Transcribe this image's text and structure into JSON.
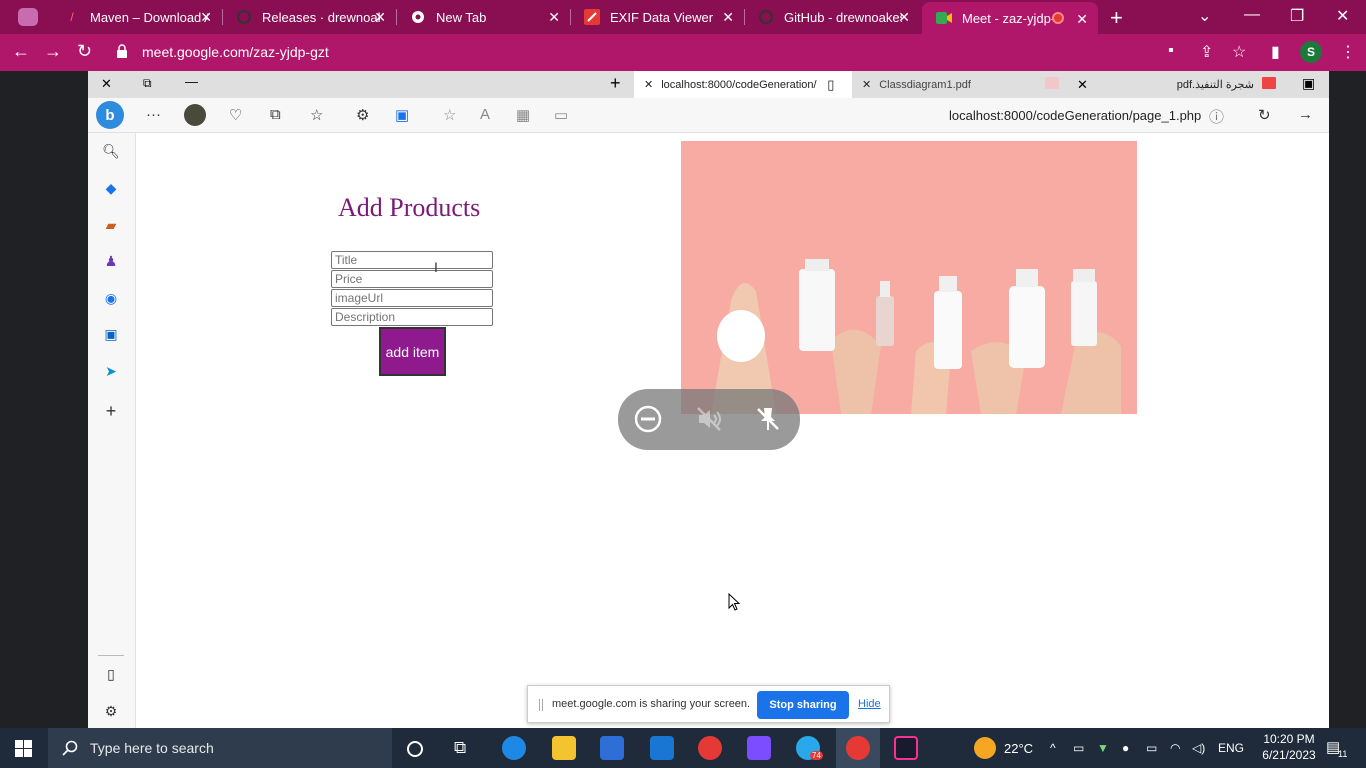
{
  "chrome": {
    "tabs": [
      {
        "title": "Maven – Download A",
        "icon": "maven-icon"
      },
      {
        "title": "Releases · drewnoake",
        "icon": "github-icon"
      },
      {
        "title": "New Tab",
        "icon": "chrome-icon"
      },
      {
        "title": "EXIF Data Viewer",
        "icon": "exif-icon"
      },
      {
        "title": "GitHub - drewnoakes",
        "icon": "github-icon"
      },
      {
        "title": "Meet - zaz-yjdp-",
        "icon": "meet-icon"
      }
    ],
    "url": "meet.google.com/zaz-yjdp-gzt",
    "profile_initial": "S"
  },
  "edge": {
    "tabs": [
      {
        "title": "localhost:8000/codeGeneration/"
      },
      {
        "title": "Classdiagram1.pdf"
      },
      {
        "title": "pdf.شجرة التنفيذ"
      }
    ],
    "url": "localhost:8000/codeGeneration/page_1.php"
  },
  "page": {
    "heading": "Add Products",
    "fields": {
      "title_placeholder": "Title",
      "price_placeholder": "Price",
      "image_placeholder": "imageUrl",
      "description_placeholder": "Description"
    },
    "button_label": "add item"
  },
  "share_banner": {
    "message": "meet.google.com is sharing your screen.",
    "stop_label": "Stop sharing",
    "hide_label": "Hide"
  },
  "taskbar": {
    "search_placeholder": "Type here to search",
    "temperature": "22°C",
    "language": "ENG",
    "time": "10:20 PM",
    "date": "6/21/2023",
    "telegram_badge": "74",
    "notification_count": "11"
  }
}
